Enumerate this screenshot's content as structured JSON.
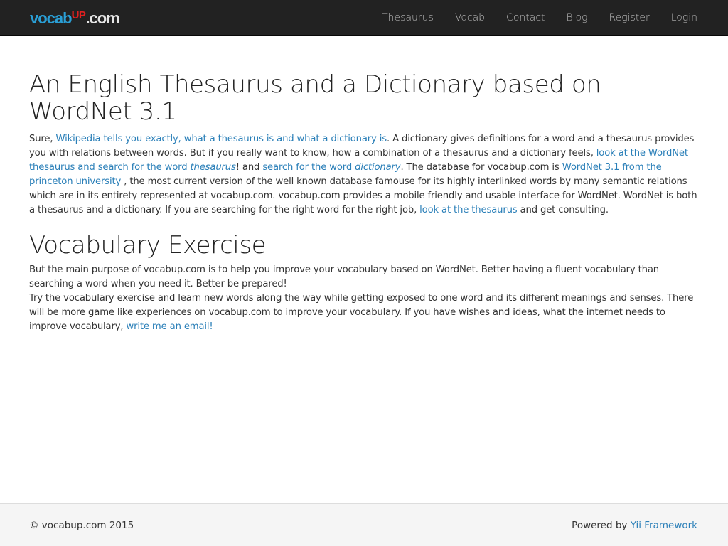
{
  "header": {
    "brand": {
      "part1": "vocab",
      "part2": "UP",
      "part3": ".com"
    },
    "nav": [
      "Thesaurus",
      "Vocab",
      "Contact",
      "Blog",
      "Register",
      "Login"
    ]
  },
  "main": {
    "title": "An English Thesaurus and a Dictionary based on WordNet 3.1",
    "intro": {
      "t1": "Sure, ",
      "l1": "Wikipedia tells you exactly, what a thesaurus is and what a dictionary is",
      "t2": ". A dictionary gives definitions for a word and a thesaurus provides you with relations between words. But if you really want to know, how a combination of a thesaurus and a dictionary feels, ",
      "l2a": "look at the WordNet thesaurus and search for the word ",
      "l2b": "thesaurus",
      "t3": "! and ",
      "l3a": "search for the word ",
      "l3b": "dictionary",
      "t4": ". The database for vocabup.com is ",
      "l4": "WordNet 3.1 from the princeton university",
      "t5": " , the most current version of the well known database famouse for its highly interlinked words by many semantic relations which are in its entirety represented at vocabup.com. vocabup.com provides a mobile friendly and usable interface for WordNet. WordNet is both a thesaurus and a dictionary. If you are searching for the right word for the right job, ",
      "l5": "look at the thesaurus",
      "t6": " and get consulting."
    },
    "section_title": "Vocabulary Exercise",
    "exercise": {
      "t1": "But the main purpose of vocabup.com is to help you improve your vocabulary based on WordNet. Better having a fluent vocabulary than searching a word when you need it. Better be prepared!",
      "t2": "Try the vocabulary exercise and learn new words along the way while getting exposed to one word and its different meanings and senses. There will be more game like experiences on vocabup.com to improve your vocabulary. If you have wishes and ideas, what the internet needs to improve vocabulary, ",
      "l1": "write me an email!"
    }
  },
  "footer": {
    "copyright": "© vocabup.com 2015",
    "powered_text": "Powered by ",
    "powered_link": "Yii Framework"
  }
}
